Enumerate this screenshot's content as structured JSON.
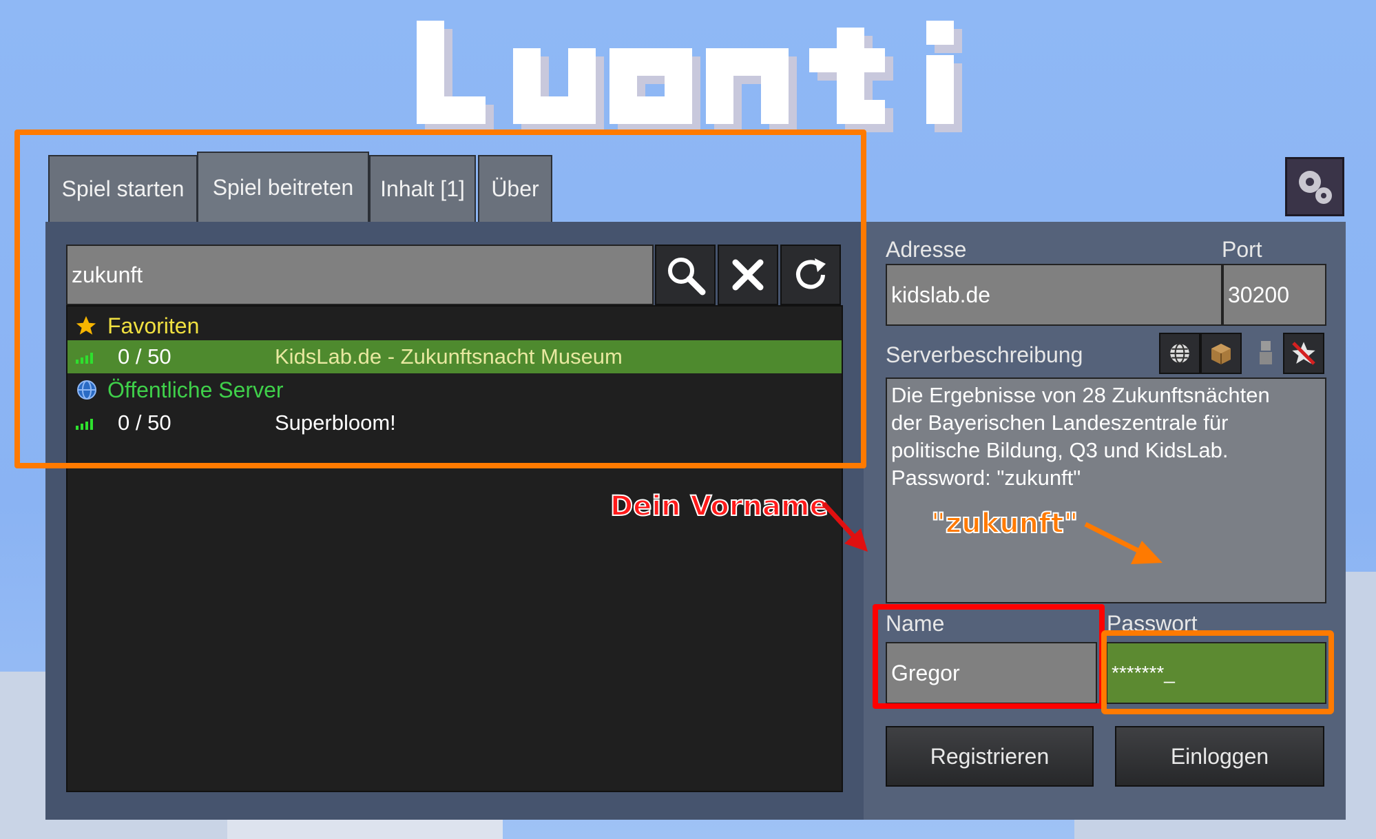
{
  "app": {
    "logo_text": "Luanti"
  },
  "tabs": [
    {
      "label": "Spiel starten"
    },
    {
      "label": "Spiel beitreten"
    },
    {
      "label": "Inhalt [1]"
    },
    {
      "label": "Über"
    }
  ],
  "search": {
    "value": "zukunft"
  },
  "server_list": {
    "favorites_header": "Favoriten",
    "favorites": [
      {
        "players": "0 / 50",
        "name": "KidsLab.de - Zukunftsnacht Museum"
      }
    ],
    "public_header": "Öffentliche Server",
    "public": [
      {
        "players": "0 / 50",
        "name": "Superbloom!"
      }
    ]
  },
  "details": {
    "address_label": "Adresse",
    "address_value": "kidslab.de",
    "port_label": "Port",
    "port_value": "30200",
    "description_label": "Serverbeschreibung",
    "description_lines": [
      "Die Ergebnisse von 28 Zukunftsnächten",
      "der Bayerischen Landeszentrale für",
      "politische Bildung, Q3 und KidsLab.",
      "Password: \"zukunft\""
    ],
    "name_label": "Name",
    "name_value": "Gregor",
    "password_label": "Passwort",
    "password_value": "*******_",
    "register_label": "Registrieren",
    "login_label": "Einloggen"
  },
  "annotations": {
    "first_name_hint": "Dein Vorname",
    "password_hint": "\"zukunft\""
  },
  "colors": {
    "favorites": "#f0e040",
    "public": "#3fd04a",
    "selected_row": "#4e8a2e",
    "highlight_orange": "#ff7a00",
    "highlight_red": "#ff0000"
  }
}
